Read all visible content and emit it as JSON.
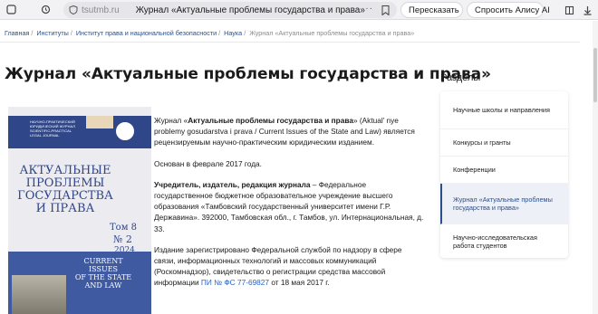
{
  "browser": {
    "host": "tsutmb.ru",
    "page_title": "Журнал «Актуальные проблемы государства и права»",
    "more_label": "···",
    "translate_label": "Пересказать",
    "alice_label": "Спросить Алису AI",
    "icons": [
      "tabs-icon",
      "refresh-icon",
      "shield-icon",
      "bookmark-icon",
      "download-icon"
    ]
  },
  "breadcrumb": {
    "items": [
      "Главная",
      "Институты",
      "Институт права и национальной безопасности",
      "Наука"
    ],
    "current": "Журнал «Актуальные проблемы государства и права»",
    "separator": "/"
  },
  "page": {
    "title": "Журнал «Актуальные проблемы государства и права»"
  },
  "cover": {
    "publisher_lines": [
      "НАУЧНО-ПРАКТИЧЕСКИЙ",
      "ЮРИДИЧЕСКИЙ ЖУРНАЛ",
      "SCIENTIFIC-PRACTICAL",
      "LEGAL JOURNAL"
    ],
    "title_lines": [
      "АКТУАЛЬНЫЕ",
      "ПРОБЛЕМЫ",
      "ГОСУДАРСТВА",
      "И ПРАВА"
    ],
    "volume": "Том 8",
    "number": "№ 2",
    "year": "2024",
    "en_title_lines": [
      "CURRENT",
      "ISSUES",
      "OF THE STATE",
      "AND LAW"
    ],
    "colors": {
      "blue": "#2f4689",
      "light": "#ecebf0"
    }
  },
  "content": {
    "p1_prefix": "Журнал «",
    "p1_bold": "Актуальные проблемы государства и права",
    "p1_rest": "» (Aktual’ nye problemy gosudarstva i prava / Current Issues of the State and Law) является рецензируемым научно-практическим юридическим изданием.",
    "p2": "Основан в феврале 2017 года.",
    "p3_bold": "Учредитель, издатель, редакция журнала",
    "p3_rest": " – Федеральное государственное бюджетное образовательное учреждение высшего образования «Тамбовский государственный университет имени Г.Р. Державина». 392000, Тамбовская обл., г. Тамбов, ул. Интернациональная, д. 33.",
    "p4_text": "Издание зарегистрировано Федеральной службой по надзору в сфере связи, информационных технологий и массовых коммуникаций (Роскомнадзор), свидетельство о регистрации средства массовой информации ",
    "p4_link": "ПИ № ФС 77-69827",
    "p4_tail": " от 18 мая 2017 г."
  },
  "sidebar": {
    "heading": "Разделы",
    "items": [
      {
        "label": "Научные школы и направления",
        "active": false
      },
      {
        "label": "Конкурсы и гранты",
        "active": false
      },
      {
        "label": "Конференции",
        "active": false
      },
      {
        "label": "Журнал «Актуальные проблемы государства и права»",
        "active": true
      },
      {
        "label": "Научно-исследовательская работа студентов",
        "active": false
      }
    ]
  }
}
